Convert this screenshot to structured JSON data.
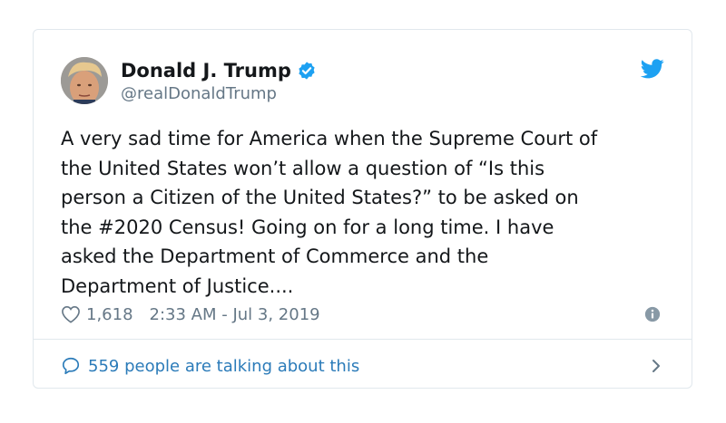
{
  "author": {
    "display_name": "Donald J. Trump",
    "handle": "@realDonaldTrump",
    "verified": true
  },
  "tweet": {
    "text": "A very sad time for America when the Supreme Court of\nthe United States won’t allow a question of “Is this\nperson a Citizen of the United States?” to be asked on\nthe #2020 Census! Going on for a long time. I have\nasked the Department of Commerce and the\nDepartment of Justice....",
    "likes": "1,618",
    "timestamp": "2:33 AM - Jul 3, 2019"
  },
  "footer": {
    "talking_label": "559 people are talking about this"
  },
  "icons": {
    "brand": "twitter-bird-icon",
    "verified": "verified-badge-icon",
    "like": "heart-icon",
    "info": "info-icon",
    "reply": "speech-bubble-icon",
    "more": "chevron-right-icon"
  },
  "colors": {
    "twitter_blue": "#1da1f2",
    "link_blue": "#2b7bb9",
    "secondary_text": "#657786",
    "border": "#e1e8ed"
  }
}
